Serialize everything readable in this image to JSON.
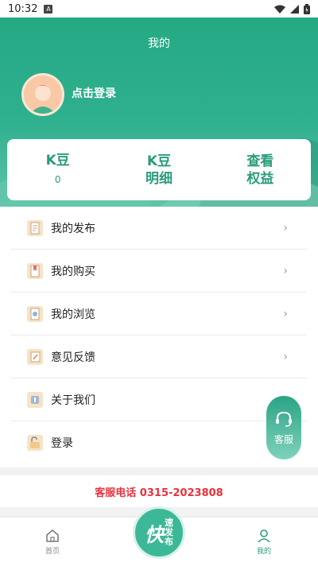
{
  "status_bar": {
    "time": "10:32",
    "notif_icon": "A"
  },
  "header": {
    "title": "我的",
    "login_text": "点击登录",
    "bg_color": "#2aa887"
  },
  "stats": [
    {
      "title": "K豆",
      "value": "0"
    },
    {
      "title_line1": "K豆",
      "title_line2": "明细"
    },
    {
      "title_line1": "查看",
      "title_line2": "权益"
    }
  ],
  "menu": {
    "items": [
      {
        "label": "我的发布",
        "icon": "document-icon",
        "chevron": "›"
      },
      {
        "label": "我的购买",
        "icon": "bookmark-icon",
        "chevron": "›"
      },
      {
        "label": "我的浏览",
        "icon": "browse-icon",
        "chevron": "›"
      },
      {
        "label": "意见反馈",
        "icon": "edit-icon",
        "chevron": "›"
      },
      {
        "label": "关于我们",
        "icon": "info-icon"
      },
      {
        "label": "登录",
        "icon": "unlock-icon"
      }
    ]
  },
  "service_phone": "客服电话 0315-2023808",
  "float_service": {
    "label": "客服"
  },
  "tabbar": {
    "home_label": "首页",
    "mine_label": "我的",
    "center_big": "快",
    "center_small_1": "速",
    "center_small_2": "发",
    "center_small_3": "布"
  },
  "colors": {
    "accent": "#2a9c7c",
    "phone_red": "#e8313d"
  }
}
